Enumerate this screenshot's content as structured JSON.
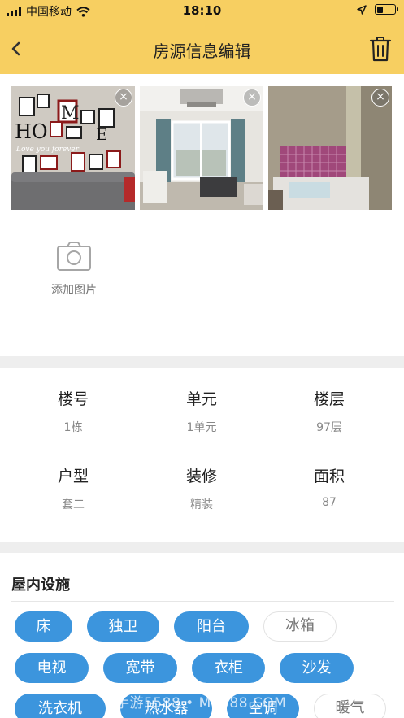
{
  "status_bar": {
    "carrier": "中国移动",
    "time": "18:10",
    "battery_level": 0.35,
    "icons": [
      "signal-icon",
      "wifi-icon",
      "location-arrow-icon",
      "battery-icon"
    ]
  },
  "nav": {
    "title": "房源信息编辑",
    "back_icon": "chevron-left-icon",
    "delete_icon": "trash-icon"
  },
  "photos": [
    {
      "description": "living-room-photo-wall",
      "close_glyph": "×"
    },
    {
      "description": "living-room-balcony",
      "close_glyph": "×"
    },
    {
      "description": "bedroom",
      "close_glyph": "×"
    }
  ],
  "add_photo": {
    "label": "添加图片",
    "icon": "camera-icon"
  },
  "info": [
    {
      "label": "楼号",
      "value": "1栋"
    },
    {
      "label": "单元",
      "value": "1单元"
    },
    {
      "label": "楼层",
      "value": "97层"
    },
    {
      "label": "户型",
      "value": "套二"
    },
    {
      "label": "装修",
      "value": "精装"
    },
    {
      "label": "面积",
      "value": "87"
    }
  ],
  "facilities": {
    "title": "屋内设施",
    "items": [
      {
        "label": "床",
        "selected": true
      },
      {
        "label": "独卫",
        "selected": true
      },
      {
        "label": "阳台",
        "selected": true
      },
      {
        "label": "冰箱",
        "selected": false
      },
      {
        "label": "电视",
        "selected": true
      },
      {
        "label": "宽带",
        "selected": true
      },
      {
        "label": "衣柜",
        "selected": true
      },
      {
        "label": "沙发",
        "selected": true
      },
      {
        "label": "洗衣机",
        "selected": true
      },
      {
        "label": "热水器",
        "selected": true
      },
      {
        "label": "空调",
        "selected": true
      },
      {
        "label": "暖气",
        "selected": false
      }
    ]
  },
  "watermark": "手游5588 • M5588.COM",
  "colors": {
    "header": "#f7cf61",
    "tag_selected": "#3c95dd",
    "section_gap": "#eeeeee"
  }
}
